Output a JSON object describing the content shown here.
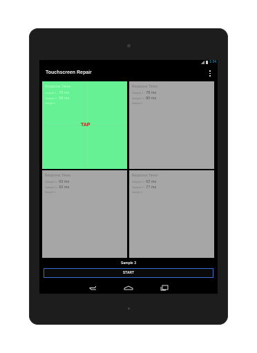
{
  "app": {
    "title": "Touchscreen Repair"
  },
  "status": {
    "time": "1:34"
  },
  "cells": [
    {
      "label": "Response Times",
      "s1_label": "Sample 1 :",
      "s1_value": "78 ms",
      "s2_label": "Sample 2 :",
      "s2_value": "58 ms",
      "s3_label": "Sample 3",
      "overlay": "TAP"
    },
    {
      "label": "Response Times",
      "s1_label": "Sample 1 :",
      "s1_value": "78 ms",
      "s2_label": "Sample 2 :",
      "s2_value": "80 ms",
      "s3_label": "Sample 3"
    },
    {
      "label": "Response Times",
      "s1_label": "Sample 1 :",
      "s1_value": "63 ms",
      "s2_label": "Sample 2 :",
      "s2_value": "92 ms",
      "s3_label": "Sample 3"
    },
    {
      "label": "Response Times",
      "s1_label": "Sample 1 :",
      "s1_value": "62 ms",
      "s2_label": "Sample 2 :",
      "s2_value": "77 ms",
      "s3_label": "Sample 3"
    }
  ],
  "footer": {
    "sample_label": "Sample 3",
    "start_label": "START"
  },
  "colors": {
    "active_cell": "#66f294",
    "cell": "#a6a6a6",
    "tap_text": "#d21919",
    "button_border": "#3a6fd0",
    "clock": "#33b5e5"
  },
  "icons": {
    "overflow": "overflow-menu-icon",
    "back": "back-icon",
    "home": "home-icon",
    "recents": "recents-icon"
  }
}
